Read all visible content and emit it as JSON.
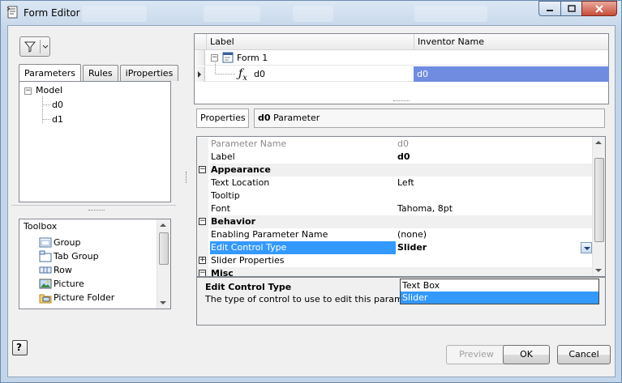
{
  "window": {
    "title": "Form Editor",
    "controls": [
      "minimize",
      "maximize",
      "close"
    ]
  },
  "left": {
    "filter_icon": "funnel-icon",
    "tabs": [
      {
        "label": "Parameters",
        "active": true
      },
      {
        "label": "Rules",
        "active": false
      },
      {
        "label": "iProperties",
        "active": false
      }
    ],
    "tree": {
      "root": "Model",
      "children": [
        "d0",
        "d1"
      ]
    },
    "toolbox": {
      "header": "Toolbox",
      "items": [
        {
          "label": "Group",
          "icon": "group-icon"
        },
        {
          "label": "Tab Group",
          "icon": "tab-group-icon"
        },
        {
          "label": "Row",
          "icon": "row-icon"
        },
        {
          "label": "Picture",
          "icon": "picture-icon"
        },
        {
          "label": "Picture Folder",
          "icon": "picture-folder-icon"
        }
      ]
    }
  },
  "form_grid": {
    "columns": [
      "Label",
      "Inventor Name"
    ],
    "rows": [
      {
        "label": "Form 1",
        "inventor_name": ""
      },
      {
        "label": "d0",
        "inventor_name": "d0"
      }
    ]
  },
  "properties": {
    "tab_label": "Properties",
    "title_bold": "d0",
    "title_rest": "Parameter",
    "rows": [
      {
        "type": "prop",
        "name": "Parameter Name",
        "value": "d0",
        "disabled": true
      },
      {
        "type": "prop",
        "name": "Label",
        "value": "d0",
        "bold_value": true
      },
      {
        "type": "category",
        "name": "Appearance",
        "expander": "−"
      },
      {
        "type": "prop",
        "name": "Text Location",
        "value": "Left"
      },
      {
        "type": "prop",
        "name": "Tooltip",
        "value": ""
      },
      {
        "type": "prop",
        "name": "Font",
        "value": "Tahoma, 8pt"
      },
      {
        "type": "category",
        "name": "Behavior",
        "expander": "−"
      },
      {
        "type": "prop",
        "name": "Enabling Parameter Name",
        "value": "(none)"
      },
      {
        "type": "prop",
        "name": "Edit Control Type",
        "value": "Slider",
        "selected": true
      },
      {
        "type": "prop",
        "name": "Slider Properties",
        "value": "",
        "expander": "+"
      },
      {
        "type": "category",
        "name": "Misc",
        "expander": "−"
      }
    ],
    "dropdown_options": [
      "Text Box",
      "Slider"
    ],
    "dropdown_highlighted": "Slider",
    "description_title": "Edit Control Type",
    "description_text": "The type of control to use to edit this parameter."
  },
  "footer": {
    "help": "?",
    "preview": "Preview",
    "ok": "OK",
    "cancel": "Cancel"
  }
}
